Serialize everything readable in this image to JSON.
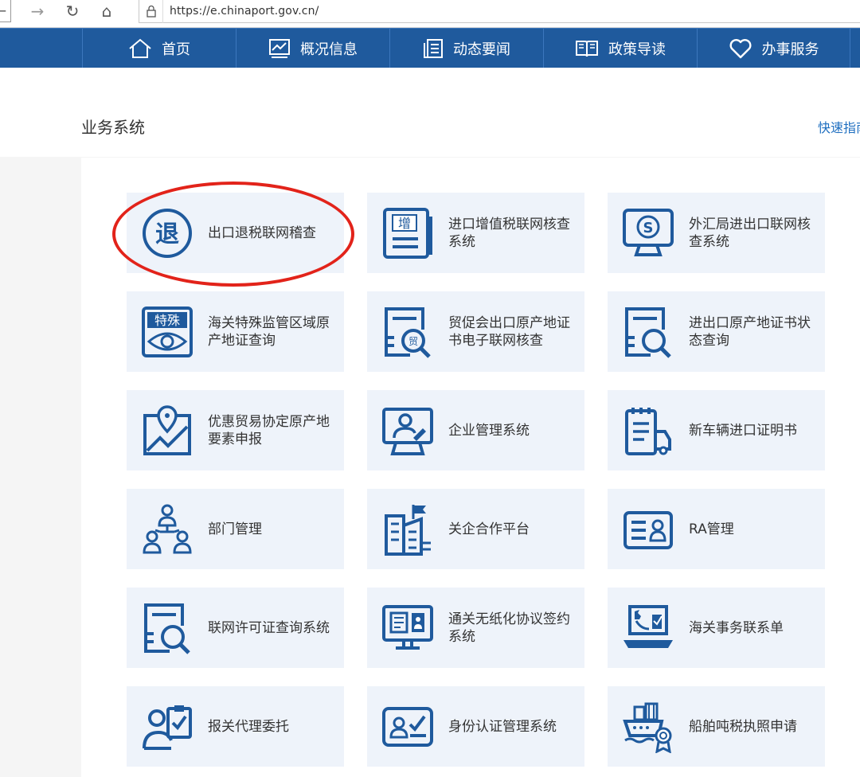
{
  "browser": {
    "url": "https://e.chinaport.gov.cn/"
  },
  "nav": [
    {
      "label": "首页",
      "icon": "home-icon"
    },
    {
      "label": "概况信息",
      "icon": "chart-icon"
    },
    {
      "label": "动态要闻",
      "icon": "news-icon"
    },
    {
      "label": "政策导读",
      "icon": "book-icon"
    },
    {
      "label": "办事服务",
      "icon": "heart-icon"
    }
  ],
  "section": {
    "title": "业务系统",
    "quick_guide": "快速指南"
  },
  "cards": [
    {
      "label": "出口退税联网稽查",
      "icon": "tax-refund-icon"
    },
    {
      "label": "进口增值税联网核查系统",
      "icon": "vat-document-icon"
    },
    {
      "label": "外汇局进出口联网核查系统",
      "icon": "forex-monitor-icon"
    },
    {
      "label": "海关特殊监管区域原产地证查询",
      "icon": "special-zone-eye-icon"
    },
    {
      "label": "贸促会出口原产地证书电子联网核查",
      "icon": "trade-certificate-search-icon"
    },
    {
      "label": "进出口原产地证书状态查询",
      "icon": "certificate-search-icon"
    },
    {
      "label": "优惠贸易协定原产地要素申报",
      "icon": "map-pin-chart-icon"
    },
    {
      "label": "企业管理系统",
      "icon": "enterprise-user-icon"
    },
    {
      "label": "新车辆进口证明书",
      "icon": "vehicle-clipboard-icon"
    },
    {
      "label": "部门管理",
      "icon": "org-users-icon"
    },
    {
      "label": "关企合作平台",
      "icon": "building-flag-icon"
    },
    {
      "label": "RA管理",
      "icon": "id-card-icon"
    },
    {
      "label": "联网许可证查询系统",
      "icon": "license-search-icon"
    },
    {
      "label": "通关无纸化协议签约系统",
      "icon": "paperless-monitor-icon"
    },
    {
      "label": "海关事务联系单",
      "icon": "laptop-contact-icon"
    },
    {
      "label": "报关代理委托",
      "icon": "agent-clipboard-icon"
    },
    {
      "label": "身份认证管理系统",
      "icon": "identity-check-icon"
    },
    {
      "label": "船舶吨税执照申请",
      "icon": "ship-tonnage-icon"
    }
  ],
  "colors": {
    "nav_bg": "#1f5a9d",
    "card_bg": "#eef3fa",
    "icon_color": "#1f5a9d",
    "highlight": "#e2231a"
  }
}
